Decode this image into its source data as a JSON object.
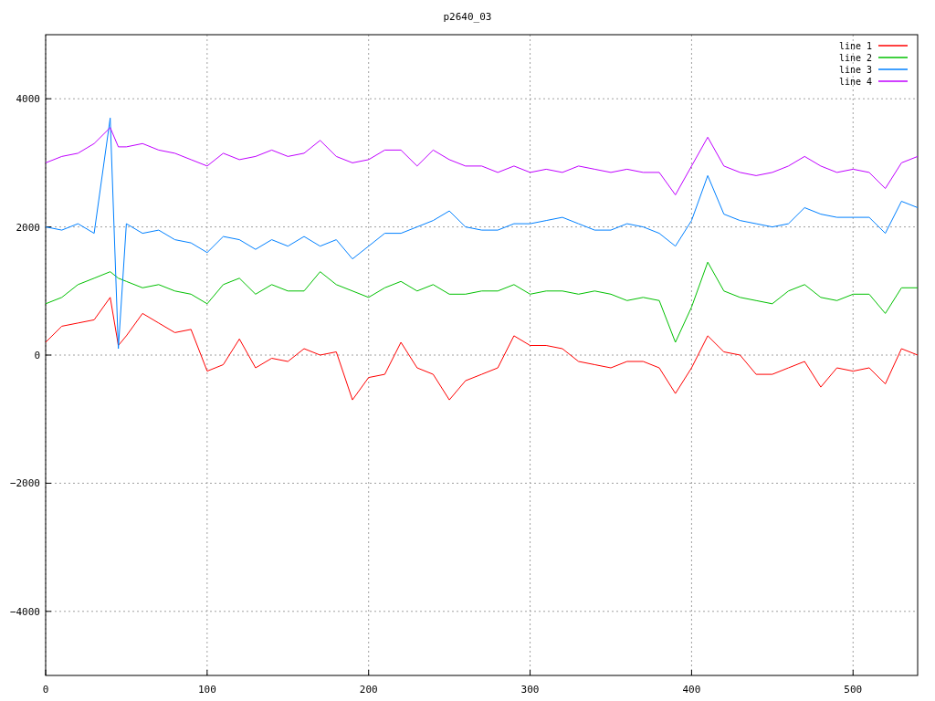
{
  "chart_data": {
    "type": "line",
    "title": "p2640_03",
    "x": [
      0,
      10,
      20,
      30,
      40,
      45,
      50,
      60,
      70,
      80,
      90,
      100,
      110,
      120,
      130,
      140,
      150,
      160,
      170,
      180,
      190,
      200,
      210,
      220,
      230,
      240,
      250,
      260,
      270,
      280,
      290,
      300,
      310,
      320,
      330,
      340,
      350,
      360,
      370,
      380,
      390,
      400,
      410,
      420,
      430,
      440,
      450,
      460,
      470,
      480,
      490,
      500,
      510,
      520,
      530,
      540
    ],
    "series": [
      {
        "name": "line 1",
        "color": "#ff0000",
        "values": [
          200,
          450,
          500,
          550,
          900,
          150,
          300,
          650,
          500,
          350,
          400,
          -250,
          -150,
          250,
          -200,
          -50,
          -100,
          100,
          0,
          50,
          -700,
          -350,
          -300,
          200,
          -200,
          -300,
          -700,
          -400,
          -300,
          -200,
          300,
          150,
          150,
          100,
          -100,
          -150,
          -200,
          -100,
          -100,
          -200,
          -600,
          -200,
          300,
          50,
          0,
          -300,
          -300,
          -200,
          -100,
          -500,
          -200,
          -250,
          -200,
          -450,
          100,
          0
        ]
      },
      {
        "name": "line 2",
        "color": "#00c000",
        "values": [
          800,
          900,
          1100,
          1200,
          1300,
          1200,
          1150,
          1050,
          1100,
          1000,
          950,
          800,
          1100,
          1200,
          950,
          1100,
          1000,
          1000,
          1300,
          1100,
          1000,
          900,
          1050,
          1150,
          1000,
          1100,
          950,
          950,
          1000,
          1000,
          1100,
          950,
          1000,
          1000,
          950,
          1000,
          950,
          850,
          900,
          850,
          200,
          750,
          1450,
          1000,
          900,
          850,
          800,
          1000,
          1100,
          900,
          850,
          950,
          950,
          650,
          1050,
          1050
        ]
      },
      {
        "name": "line 3",
        "color": "#0080ff",
        "values": [
          2000,
          1950,
          2050,
          1900,
          3700,
          100,
          2050,
          1900,
          1950,
          1800,
          1750,
          1600,
          1850,
          1800,
          1650,
          1800,
          1700,
          1850,
          1700,
          1800,
          1500,
          1700,
          1900,
          1900,
          2000,
          2100,
          2250,
          2000,
          1950,
          1950,
          2050,
          2050,
          2100,
          2150,
          2050,
          1950,
          1950,
          2050,
          2000,
          1900,
          1700,
          2100,
          2800,
          2200,
          2100,
          2050,
          2000,
          2050,
          2300,
          2200,
          2150,
          2150,
          2150,
          1900,
          2400,
          2300
        ]
      },
      {
        "name": "line 4",
        "color": "#c000ff",
        "values": [
          3000,
          3100,
          3150,
          3300,
          3550,
          3250,
          3250,
          3300,
          3200,
          3150,
          3050,
          2950,
          3150,
          3050,
          3100,
          3200,
          3100,
          3150,
          3350,
          3100,
          3000,
          3050,
          3200,
          3200,
          2950,
          3200,
          3050,
          2950,
          2950,
          2850,
          2950,
          2850,
          2900,
          2850,
          2950,
          2900,
          2850,
          2900,
          2850,
          2850,
          2500,
          2950,
          3400,
          2950,
          2850,
          2800,
          2850,
          2950,
          3100,
          2950,
          2850,
          2900,
          2850,
          2600,
          3000,
          3100
        ]
      }
    ],
    "xlim": [
      0,
      540
    ],
    "ylim": [
      -5000,
      5000
    ],
    "grid": true,
    "legend": true,
    "xticks": [
      0,
      100,
      200,
      300,
      400,
      500
    ],
    "yticks": [
      {
        "value": -4000,
        "label": "−4000"
      },
      {
        "value": -2000,
        "label": "−2000"
      },
      0,
      2000,
      4000
    ]
  }
}
